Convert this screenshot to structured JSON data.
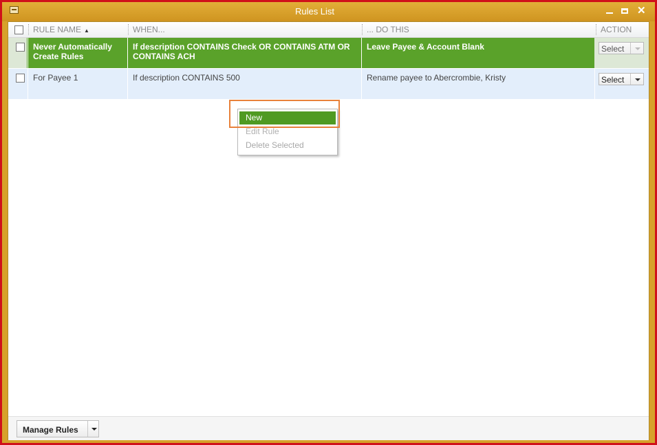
{
  "window": {
    "title": "Rules List"
  },
  "table": {
    "columns": [
      {
        "label": "RULE NAME",
        "sorted": "asc"
      },
      {
        "label": "WHEN..."
      },
      {
        "label": "... DO THIS"
      },
      {
        "label": "ACTION"
      }
    ],
    "rows": [
      {
        "name": "Never Automatically Create Rules",
        "when": "If description  CONTAINS Check OR CONTAINS ATM OR CONTAINS ACH",
        "action": "Leave Payee & Account Blank",
        "button": "Select",
        "selected": true
      },
      {
        "name": "For Payee 1",
        "when": "If description  CONTAINS 500",
        "action": "Rename payee to Abercrombie, Kristy",
        "button": "Select",
        "selected": false
      }
    ]
  },
  "context_menu": {
    "items": [
      {
        "label": "New",
        "enabled": true,
        "highlighted": true
      },
      {
        "label": "Edit Rule",
        "enabled": false
      },
      {
        "label": "Delete Selected",
        "enabled": false
      }
    ]
  },
  "footer": {
    "manage_label": "Manage Rules"
  },
  "colors": {
    "titlebar": "#d7a12a",
    "border": "#d0101a",
    "selected_row": "#5aa22a",
    "row_alt": "#e3eefb",
    "highlight_box": "#e8813a"
  }
}
